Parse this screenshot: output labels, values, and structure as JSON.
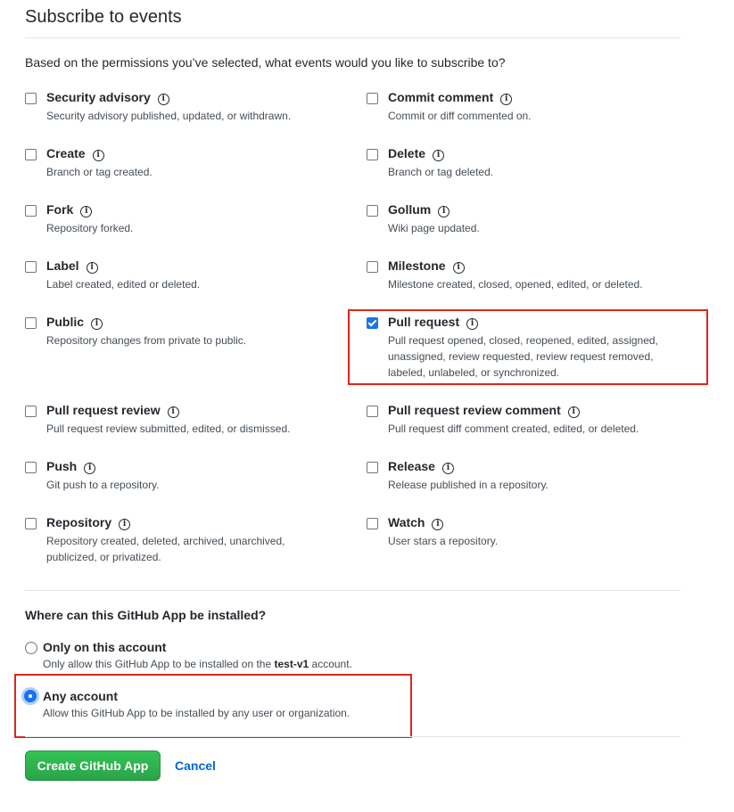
{
  "page": {
    "title": "Subscribe to events",
    "question": "Based on the permissions you’ve selected, what events would you like to subscribe to?"
  },
  "events": {
    "security_advisory": {
      "name": "Security advisory",
      "desc": "Security advisory published, updated, or withdrawn.",
      "checked": false
    },
    "commit_comment": {
      "name": "Commit comment",
      "desc": "Commit or diff commented on.",
      "checked": false
    },
    "create": {
      "name": "Create",
      "desc": "Branch or tag created.",
      "checked": false
    },
    "delete": {
      "name": "Delete",
      "desc": "Branch or tag deleted.",
      "checked": false
    },
    "fork": {
      "name": "Fork",
      "desc": "Repository forked.",
      "checked": false
    },
    "gollum": {
      "name": "Gollum",
      "desc": "Wiki page updated.",
      "checked": false
    },
    "label": {
      "name": "Label",
      "desc": "Label created, edited or deleted.",
      "checked": false
    },
    "milestone": {
      "name": "Milestone",
      "desc": "Milestone created, closed, opened, edited, or deleted.",
      "checked": false
    },
    "public": {
      "name": "Public",
      "desc": "Repository changes from private to public.",
      "checked": false
    },
    "pull_request": {
      "name": "Pull request",
      "desc_lines": [
        "Pull request opened, closed, reopened, edited, assigned,",
        "unassigned, review requested, review request removed,",
        "labeled, unlabeled, or synchronized."
      ],
      "checked": true
    },
    "pull_request_review": {
      "name": "Pull request review",
      "desc": "Pull request review submitted, edited, or dismissed.",
      "checked": false
    },
    "pull_request_review_comment": {
      "name": "Pull request review comment",
      "desc": "Pull request diff comment created, edited, or deleted.",
      "checked": false
    },
    "push": {
      "name": "Push",
      "desc": "Git push to a repository.",
      "checked": false
    },
    "release": {
      "name": "Release",
      "desc": "Release published in a repository.",
      "checked": false
    },
    "repository": {
      "name": "Repository",
      "desc_lines": [
        "Repository created, deleted, archived, unarchived,",
        "publicized, or privatized."
      ],
      "checked": false
    },
    "watch": {
      "name": "Watch",
      "desc": "User stars a repository.",
      "checked": false
    }
  },
  "install": {
    "title": "Where can this GitHub App be installed?",
    "only_this": {
      "label": "Only on this account",
      "desc_prefix": "Only allow this GitHub App to be installed on the",
      "account": "test-v1",
      "desc_suffix": "account.",
      "selected": false
    },
    "any": {
      "label": "Any account",
      "desc": "Allow this GitHub App to be installed by any user or organization.",
      "selected": true
    }
  },
  "actions": {
    "create_label": "Create GitHub App",
    "cancel_label": "Cancel"
  },
  "colors": {
    "highlight": "#e0261b",
    "primary_green": "#2ea44f",
    "link_blue": "#0366d6",
    "check_blue": "#1a73e8"
  },
  "icons": {
    "info": "info-icon"
  }
}
